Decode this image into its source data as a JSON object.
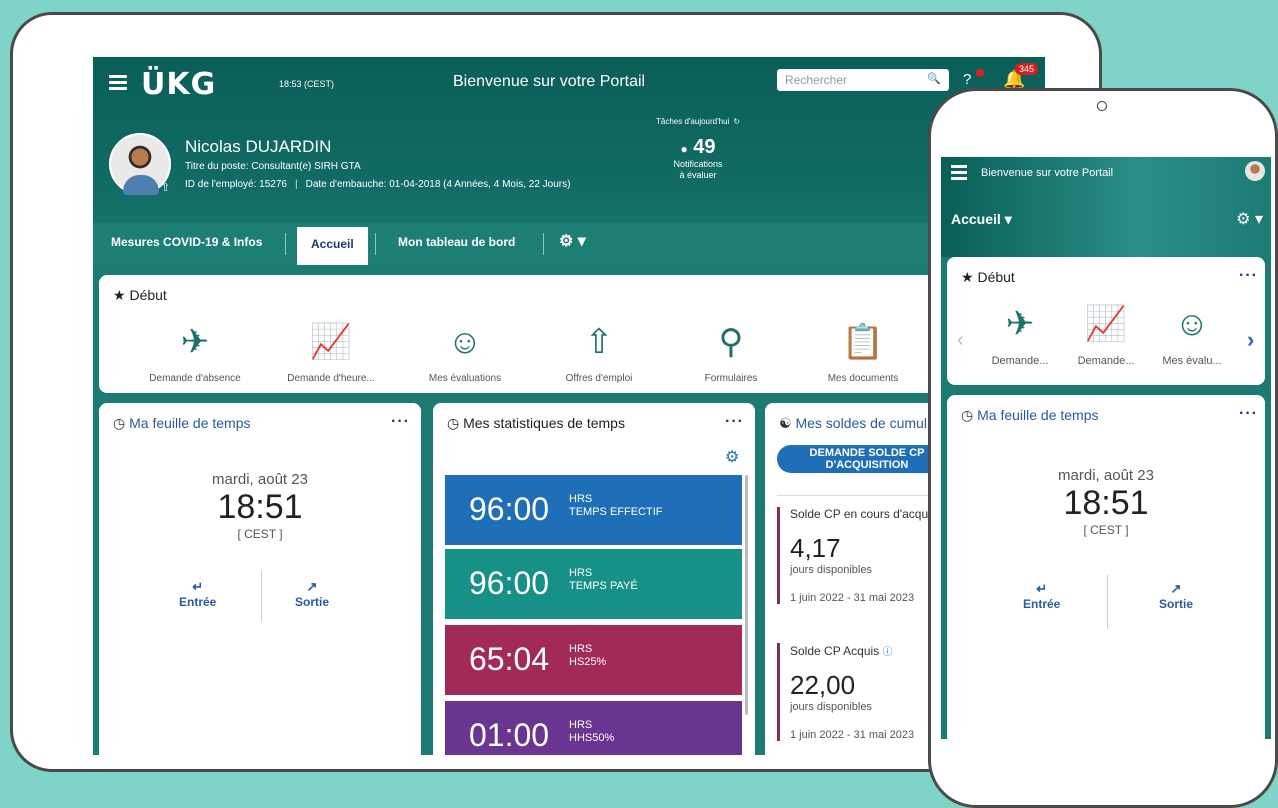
{
  "tablet": {
    "header": {
      "logo": "ÜKG",
      "time": "18:53 (CEST)",
      "title": "Bienvenue sur votre Portail",
      "search_placeholder": "Rechercher",
      "notification_count": "345"
    },
    "employee": {
      "name": "Nicolas DUJARDIN",
      "job_title": "Titre du poste: Consultant(e) SIRH GTA",
      "employee_id": "ID de l'employé: 15276",
      "hire_date": "Date d'embauche: 01-04-2018 (4 Années, 4 Mois, 22 Jours)"
    },
    "tasks": {
      "title": "Tâches d'aujourd'hui",
      "count": "49",
      "label_line1": "Notifications",
      "label_line2": "à évaluer"
    },
    "nav": {
      "tab1": "Mesures COVID-19 & Infos",
      "tab2": "Accueil",
      "tab3": "Mon tableau de bord"
    },
    "start_card": {
      "title": "Début",
      "shortcuts": [
        "Demande d'absence",
        "Demande d'heure...",
        "Mes évaluations",
        "Offres d'emploi",
        "Formulaires",
        "Mes documents"
      ]
    },
    "timesheet": {
      "title": "Ma feuille de temps",
      "date": "mardi, août 23",
      "time": "18:51",
      "tz": "[ CEST ]",
      "in_label": "Entrée",
      "out_label": "Sortie"
    },
    "stats": {
      "title": "Mes statistiques de temps",
      "items": [
        {
          "value": "96:00",
          "unit": "HRS",
          "label": "TEMPS EFFECTIF",
          "color": "#1f6fb8"
        },
        {
          "value": "96:00",
          "unit": "HRS",
          "label": "TEMPS PAYÉ",
          "color": "#179087"
        },
        {
          "value": "65:04",
          "unit": "HRS",
          "label": "HS25%",
          "color": "#a22a58"
        },
        {
          "value": "01:00",
          "unit": "HRS",
          "label": "HHS50%",
          "color": "#6a3590"
        }
      ]
    },
    "balances": {
      "title": "Mes soldes de cumul",
      "button_line1": "DEMANDE SOLDE CP",
      "button_line2": "D'ACQUISITION",
      "items": [
        {
          "title": "Solde CP en cours d'acqui",
          "value": "4,17",
          "sub": "jours disponibles",
          "dates": "1 juin 2022 - 31 mai 2023"
        },
        {
          "title": "Solde CP Acquis",
          "value": "22,00",
          "sub": "jours disponibles",
          "dates": "1 juin 2022 - 31 mai 2023"
        }
      ]
    }
  },
  "phone": {
    "title": "Bienvenue sur votre Portail",
    "nav_label": "Accueil",
    "start_title": "Début",
    "shortcuts": [
      "Demande...",
      "Demande...",
      "Mes évalu..."
    ],
    "timesheet": {
      "title": "Ma feuille de temps",
      "date": "mardi, août 23",
      "time": "18:51",
      "tz": "[ CEST ]",
      "in_label": "Entrée",
      "out_label": "Sortie"
    }
  }
}
